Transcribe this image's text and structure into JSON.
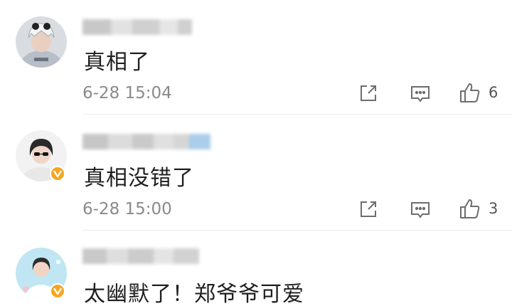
{
  "comments": [
    {
      "text": "真相了",
      "timestamp": "6-28 15:04",
      "likes": "6",
      "verified": false,
      "icons": [
        "share-icon",
        "comment-icon",
        "like-icon"
      ]
    },
    {
      "text": "真相没错了",
      "timestamp": "6-28 15:00",
      "likes": "3",
      "verified": true,
      "icons": [
        "share-icon",
        "comment-icon",
        "like-icon"
      ]
    },
    {
      "text": "太幽默了！郑爷爷可爱",
      "verified": true
    }
  ],
  "colors": {
    "text": "#1f1f1f",
    "meta": "#8a8a8a",
    "verified_badge": "#f5a623",
    "divider": "#ececec"
  }
}
